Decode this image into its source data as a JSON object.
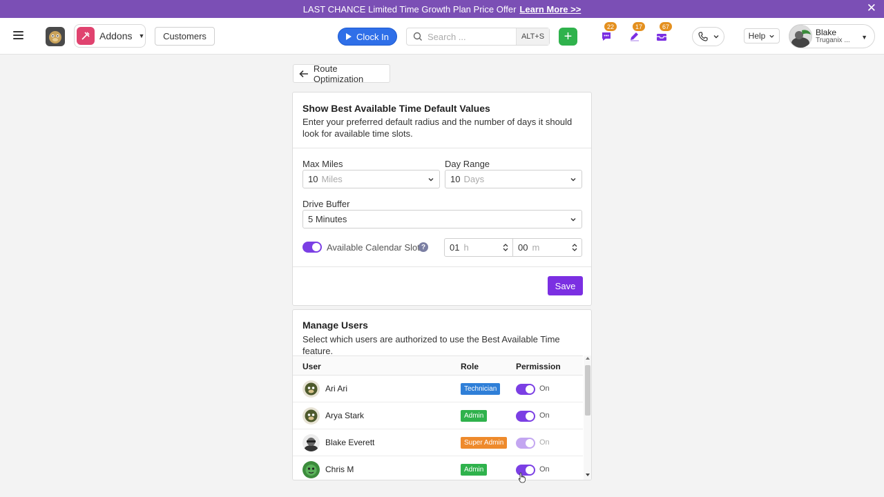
{
  "banner": {
    "text": "LAST CHANCE Limited Time Growth Plan Price Offer",
    "link": "Learn More >>",
    "close_icon": "close-icon"
  },
  "header": {
    "addons_label": "Addons",
    "customers_label": "Customers",
    "clock_in_label": "Clock In",
    "search_placeholder": "Search ...",
    "search_shortcut": "ALT+S",
    "add_label": "+",
    "chat_count": "22",
    "tasks_count": "17",
    "inbox_count": "67",
    "help_label": "Help",
    "user_name": "Blake",
    "company_name": "Truganix ..."
  },
  "back_button": {
    "label": "Route Optimization"
  },
  "defaults_card": {
    "title": "Show Best Available Time Default Values",
    "description": "Enter your preferred default radius and the number of days it should look for available time slots.",
    "max_miles": {
      "label": "Max Miles",
      "value": "10",
      "unit": "Miles"
    },
    "day_range": {
      "label": "Day Range",
      "value": "10",
      "unit": "Days"
    },
    "drive_buffer": {
      "label": "Drive Buffer",
      "value": "5 Minutes"
    },
    "calendar_slot": {
      "label": "Available Calendar Slot",
      "enabled": true,
      "help": "?",
      "hours": "01",
      "hours_unit": "h",
      "minutes": "00",
      "minutes_unit": "m"
    },
    "save_label": "Save"
  },
  "users_card": {
    "title": "Manage Users",
    "description": "Select which users are authorized to use the Best Available Time feature.",
    "columns": {
      "user": "User",
      "role": "Role",
      "permission": "Permission"
    },
    "rows": [
      {
        "name": "Ari Ari",
        "role": "Technician",
        "role_color": "#2f7fd8",
        "permission": "On",
        "disabled": false
      },
      {
        "name": "Arya Stark",
        "role": "Admin",
        "role_color": "#2fb24c",
        "permission": "On",
        "disabled": false
      },
      {
        "name": "Blake Everett",
        "role": "Super Admin",
        "role_color": "#ee8a2c",
        "permission": "On",
        "disabled": true
      },
      {
        "name": "Chris M",
        "role": "Admin",
        "role_color": "#2fb24c",
        "permission": "On",
        "disabled": false
      }
    ]
  },
  "colors": {
    "accent": "#7b2fe2",
    "banner": "#7b4fb5",
    "clock_in": "#2f6fe8",
    "add": "#2fb24c"
  }
}
